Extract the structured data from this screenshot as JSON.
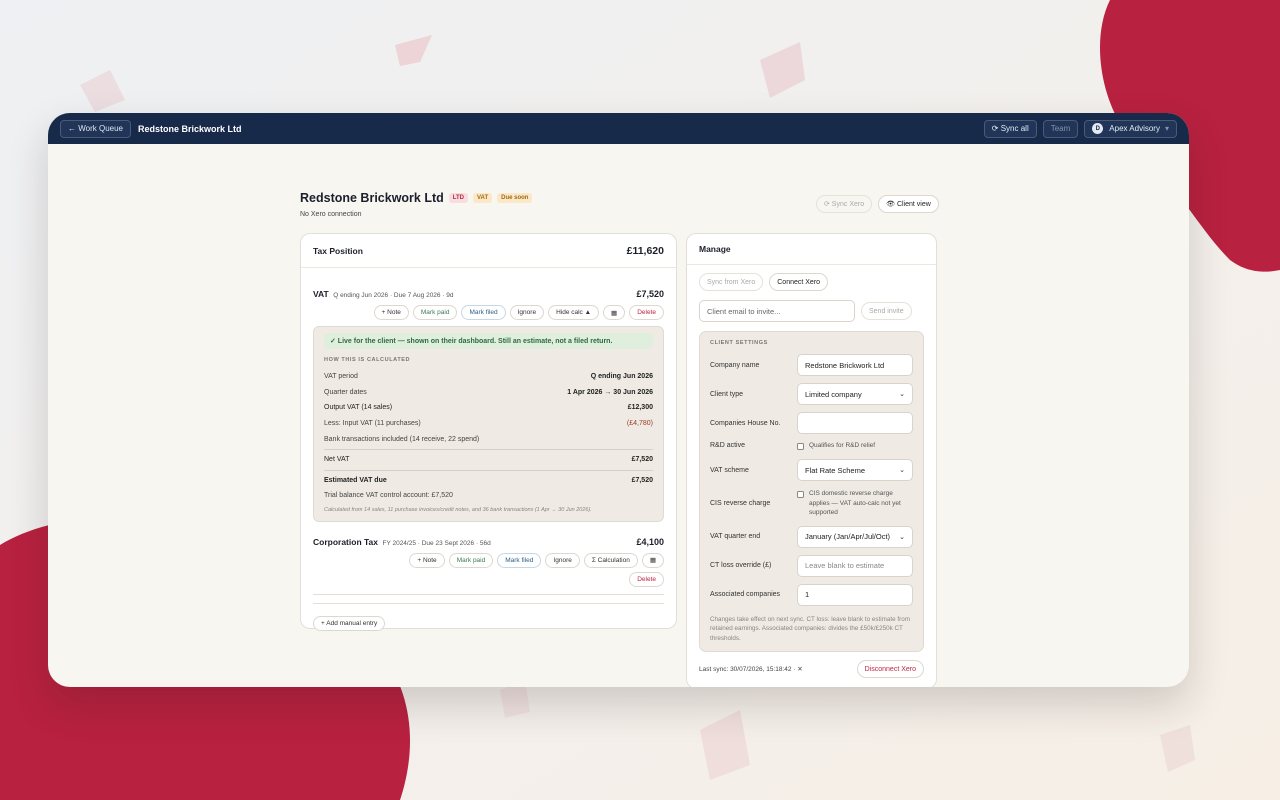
{
  "colors": {
    "brand_red": "#b8213f",
    "nav_bg": "#172a4a",
    "page_bg": "#f8f6f1",
    "accent_green": "#2e6b3e"
  },
  "topbar": {
    "back_label": "← Work Queue",
    "company": "Redstone Brickwork Ltd",
    "sync_all": "⟳ Sync all",
    "team": "Team",
    "account_initial": "D",
    "account_name": "Apex Advisory",
    "account_chevron": "▾"
  },
  "header": {
    "title": "Redstone Brickwork Ltd",
    "badges": [
      "LTD",
      "VAT",
      "Due soon"
    ],
    "subtitle": "No Xero connection",
    "sync_xero": "⟳ Sync Xero",
    "client_view": "👁 Client view"
  },
  "tax_position": {
    "title": "Tax Position",
    "total": "£11,620",
    "vat": {
      "name": "VAT",
      "meta": "Q ending Jun 2026 · Due 7 Aug 2026 · 9d",
      "amount": "£7,520",
      "actions": [
        "+ Note",
        "Mark paid",
        "Mark filed",
        "Ignore",
        "Hide calc ▲",
        "▦",
        "Delete"
      ],
      "banner": "✓ Live for the client — shown on their dashboard. Still an estimate, not a filed return.",
      "calc_heading": "HOW THIS IS CALCULATED",
      "rows": [
        {
          "label": "VAT period",
          "value": "Q ending Jun 2026"
        },
        {
          "label": "Quarter dates",
          "value": "1 Apr 2026 → 30 Jun 2026"
        },
        {
          "label": "Output VAT (14 sales)",
          "value": "£12,300"
        },
        {
          "label": "Less: Input VAT (11 purchases)",
          "value": "(£4,780)"
        },
        {
          "label": "Bank transactions included (14 receive, 22 spend)",
          "value": ""
        }
      ],
      "net_label": "Net VAT",
      "net_value": "£7,520",
      "due_label": "Estimated VAT due",
      "due_value": "£7,520",
      "trial_balance": "Trial balance VAT control account: £7,520",
      "note": "Calculated from 14 sales, 11 purchase invoices/credit notes, and 36 bank transactions (1 Apr → 30 Jun 2026)."
    },
    "ct": {
      "name": "Corporation Tax",
      "meta": "FY 2024/25 · Due 23 Sept 2026 · 56d",
      "amount": "£4,100",
      "actions": [
        "+ Note",
        "Mark paid",
        "Mark filed",
        "Ignore",
        "Σ Calculation",
        "▦",
        "Delete"
      ]
    },
    "add_manual": "+ Add manual entry"
  },
  "manage": {
    "title": "Manage",
    "sync_from_xero": "Sync from Xero",
    "connect_xero": "Connect Xero",
    "invite_placeholder": "Client email to invite...",
    "send_invite": "Send invite",
    "settings_heading": "CLIENT SETTINGS",
    "company_name_label": "Company name",
    "company_name_value": "Redstone Brickwork Ltd",
    "client_type_label": "Client type",
    "client_type_value": "Limited company",
    "ch_no_label": "Companies House No.",
    "ch_no_value": "",
    "rd_label": "R&D active",
    "rd_text": "Qualifies for R&D relief",
    "vat_scheme_label": "VAT scheme",
    "vat_scheme_value": "Flat Rate Scheme",
    "cis_label": "CIS reverse charge",
    "cis_text": "CIS domestic reverse charge applies — VAT auto-calc not yet supported",
    "vat_qe_label": "VAT quarter end",
    "vat_qe_value": "January (Jan/Apr/Jul/Oct)",
    "ct_loss_label": "CT loss override (£)",
    "ct_loss_placeholder": "Leave blank to estimate",
    "assoc_label": "Associated companies",
    "assoc_value": "1",
    "settings_note": "Changes take effect on next sync. CT loss: leave blank to estimate from retained earnings. Associated companies: divides the £50k/£250k CT thresholds.",
    "last_sync": "Last sync: 30/07/2026, 15:18:42 · ✕",
    "disconnect": "Disconnect Xero"
  }
}
